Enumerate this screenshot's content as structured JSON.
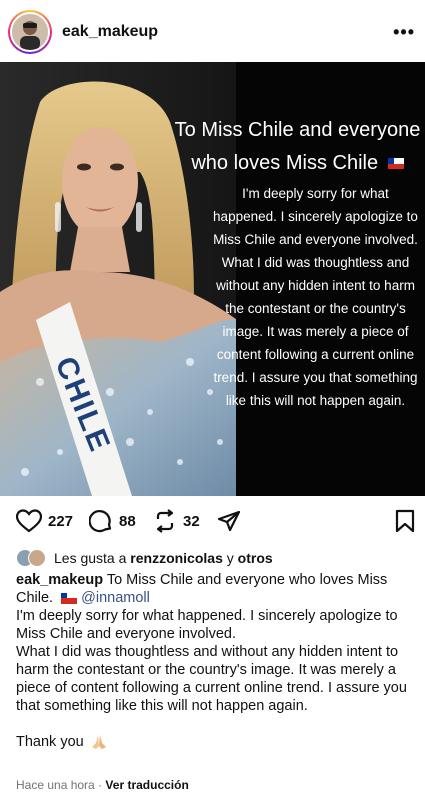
{
  "header": {
    "username": "eak_makeup",
    "more_glyph": "•••"
  },
  "image": {
    "title_line1": "To Miss Chile and everyone",
    "title_line2": "who loves Miss Chile",
    "body_lines": [
      "I'm deeply sorry for what",
      "happened. I sincerely apologize to",
      "Miss Chile and everyone involved.",
      "What I did was thoughtless and",
      "without any hidden intent to harm",
      "the contestant or the country's",
      "image. It was merely a piece of",
      "content following a current online",
      "trend. I assure you that something",
      "like this will not happen again."
    ],
    "sash_text": "CHILE"
  },
  "actions": {
    "likes": "227",
    "comments": "88",
    "reposts": "32"
  },
  "likes_row": {
    "prefix": "Les gusta a",
    "user": "renzzonicolas",
    "joiner": "y",
    "others": "otros"
  },
  "caption": {
    "username": "eak_makeup",
    "line1_text": "To Miss Chile and everyone who loves Miss",
    "line2_text": "Chile.",
    "mention": "@innamoll",
    "p1": "I'm deeply sorry for what happened. I sincerely apologize to Miss Chile and everyone involved.",
    "p2": "What I did was thoughtless and without any hidden intent to harm the contestant or the country's image. It was merely a piece of content following a current online trend. I assure you that something like this will not happen again.",
    "thanks": "Thank you"
  },
  "meta": {
    "time": "Hace una hora",
    "separator": "·",
    "translate": "Ver traducción"
  },
  "colors": {
    "accent_link": "#385185",
    "flag_red": "#d52b1e",
    "flag_blue": "#0039a6"
  }
}
